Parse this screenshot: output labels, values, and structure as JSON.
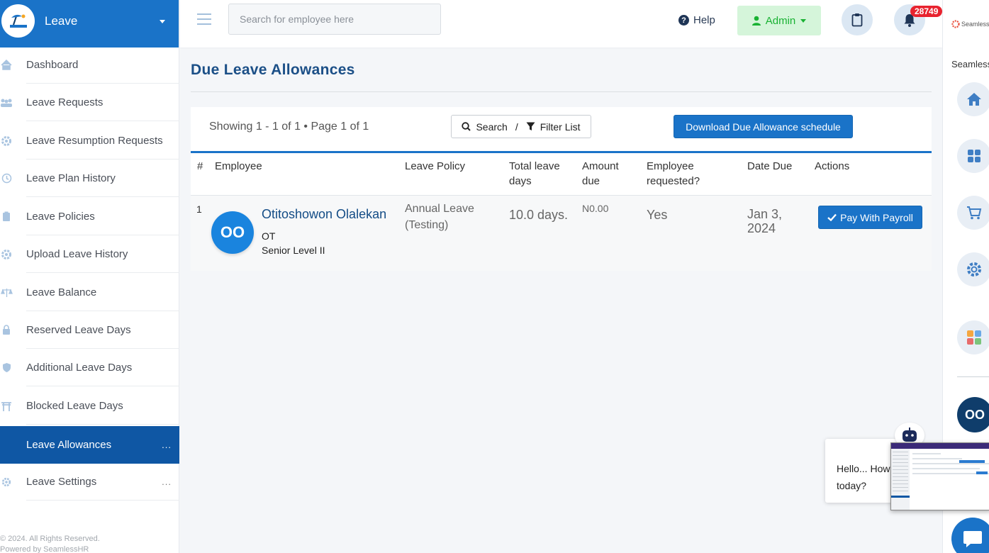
{
  "sidebar": {
    "title": "Leave",
    "items": [
      {
        "label": "Dashboard",
        "icon": "home-icon"
      },
      {
        "label": "Leave Requests",
        "icon": "people-icon"
      },
      {
        "label": "Leave Resumption Requests",
        "icon": "gear-icon"
      },
      {
        "label": "Leave Plan History",
        "icon": "history-icon"
      },
      {
        "label": "Leave Policies",
        "icon": "clipboard-icon"
      },
      {
        "label": "Upload Leave History",
        "icon": "gear-icon"
      },
      {
        "label": "Leave Balance",
        "icon": "scale-icon"
      },
      {
        "label": "Reserved Leave Days",
        "icon": "lock-icon"
      },
      {
        "label": "Additional Leave Days",
        "icon": "shield-icon"
      },
      {
        "label": "Blocked Leave Days",
        "icon": "gate-icon"
      },
      {
        "label": "Leave Allowances",
        "icon": "none",
        "active": true,
        "more": "..."
      },
      {
        "label": "Leave Settings",
        "icon": "gear-icon",
        "more": "..."
      }
    ],
    "footer_line1": "© 2024. All Rights Reserved.",
    "footer_line2": "Powered by SeamlessHR"
  },
  "topbar": {
    "search_placeholder": "Search for employee here",
    "help_label": "Help",
    "admin_label": "Admin",
    "notification_count": "28749"
  },
  "page": {
    "title": "Due Leave Allowances",
    "showing": "Showing 1 - 1 of 1 • Page 1 of 1",
    "search_label": "Search",
    "filter_separator": "/",
    "filter_label": "Filter List",
    "download_label": "Download Due Allowance schedule"
  },
  "table": {
    "headers": [
      "#",
      "Employee",
      "Leave Policy",
      "Total leave days",
      "Amount due",
      "Employee requested?",
      "Date Due",
      "Actions"
    ],
    "rows": [
      {
        "index": "1",
        "initials": "OO",
        "name": "Otitoshowon Olalekan",
        "code": "OT",
        "level": "Senior Level II",
        "policy": "Annual Leave (Testing)",
        "total_days": "10.0 days.",
        "amount": "N0.00",
        "requested": "Yes",
        "date_due": "Jan 3, 2024",
        "action_label": "Pay With Payroll"
      }
    ]
  },
  "rail": {
    "brand": "Seamless",
    "label": "Seamless",
    "avatar_initials": "OO"
  },
  "chat": {
    "greeting": "Hello... How today?"
  },
  "colors": {
    "primary": "#1a73c8",
    "active_nav": "#0f57a4",
    "admin_bg": "#d5f5da",
    "admin_text": "#19b233",
    "badge": "#e8232f"
  }
}
